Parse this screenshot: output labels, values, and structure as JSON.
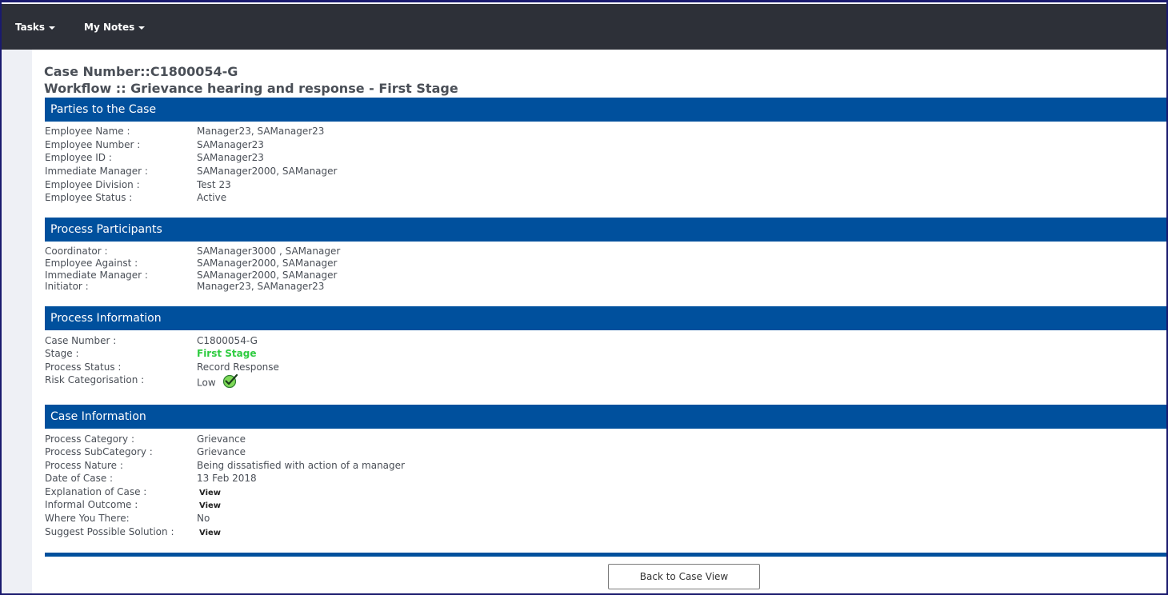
{
  "nav": {
    "tasks_label": "Tasks",
    "notes_label": "My Notes"
  },
  "header": {
    "case_number_title": "Case Number::C1800054-G",
    "workflow_title": "Workflow :: Grievance hearing and response - First Stage"
  },
  "sections": {
    "parties": {
      "title": "Parties to the Case",
      "rows": [
        {
          "label": "Employee Name :",
          "value": "Manager23, SAManager23"
        },
        {
          "label": "Employee Number :",
          "value": "SAManager23"
        },
        {
          "label": "Employee ID :",
          "value": "SAManager23"
        },
        {
          "label": "Immediate Manager :",
          "value": "SAManager2000, SAManager"
        },
        {
          "label": "Employee Division :",
          "value": "Test 23"
        },
        {
          "label": "Employee Status :",
          "value": "Active"
        }
      ]
    },
    "participants": {
      "title": "Process Participants",
      "rows": [
        {
          "label": "Coordinator :",
          "value": "SAManager3000 , SAManager"
        },
        {
          "label": "Employee Against :",
          "value": "SAManager2000, SAManager"
        },
        {
          "label": "Immediate Manager :",
          "value": "SAManager2000, SAManager"
        },
        {
          "label": "Initiator :",
          "value": "Manager23, SAManager23"
        }
      ]
    },
    "process_info": {
      "title": "Process Information",
      "rows": [
        {
          "label": "Case Number :",
          "value": "C1800054-G"
        },
        {
          "label": "Stage :",
          "value": "First Stage"
        },
        {
          "label": "Process Status :",
          "value": "Record Response"
        },
        {
          "label": "Risk Categorisation :",
          "value": "Low"
        }
      ],
      "stage_color": "#2ecc40",
      "risk_icon": "green-check-icon"
    },
    "case_info": {
      "title": "Case Information",
      "rows": [
        {
          "label": "Process Category :",
          "value": "Grievance"
        },
        {
          "label": "Process SubCategory :",
          "value": "Grievance"
        },
        {
          "label": "Process Nature :",
          "value": "Being dissatisfied with action of a manager"
        },
        {
          "label": "Date of Case :",
          "value": "13 Feb 2018"
        },
        {
          "label": "Explanation of Case :",
          "value": "View"
        },
        {
          "label": "Informal Outcome :",
          "value": "View"
        },
        {
          "label": "Where You There:",
          "value": "No"
        },
        {
          "label": "Suggest Possible Solution :",
          "value": "View"
        }
      ]
    }
  },
  "footer": {
    "back_button_label": "Back to Case View"
  },
  "colors": {
    "topbar": "#2d3038",
    "section_header": "#00509d",
    "text": "#4a4f57"
  }
}
